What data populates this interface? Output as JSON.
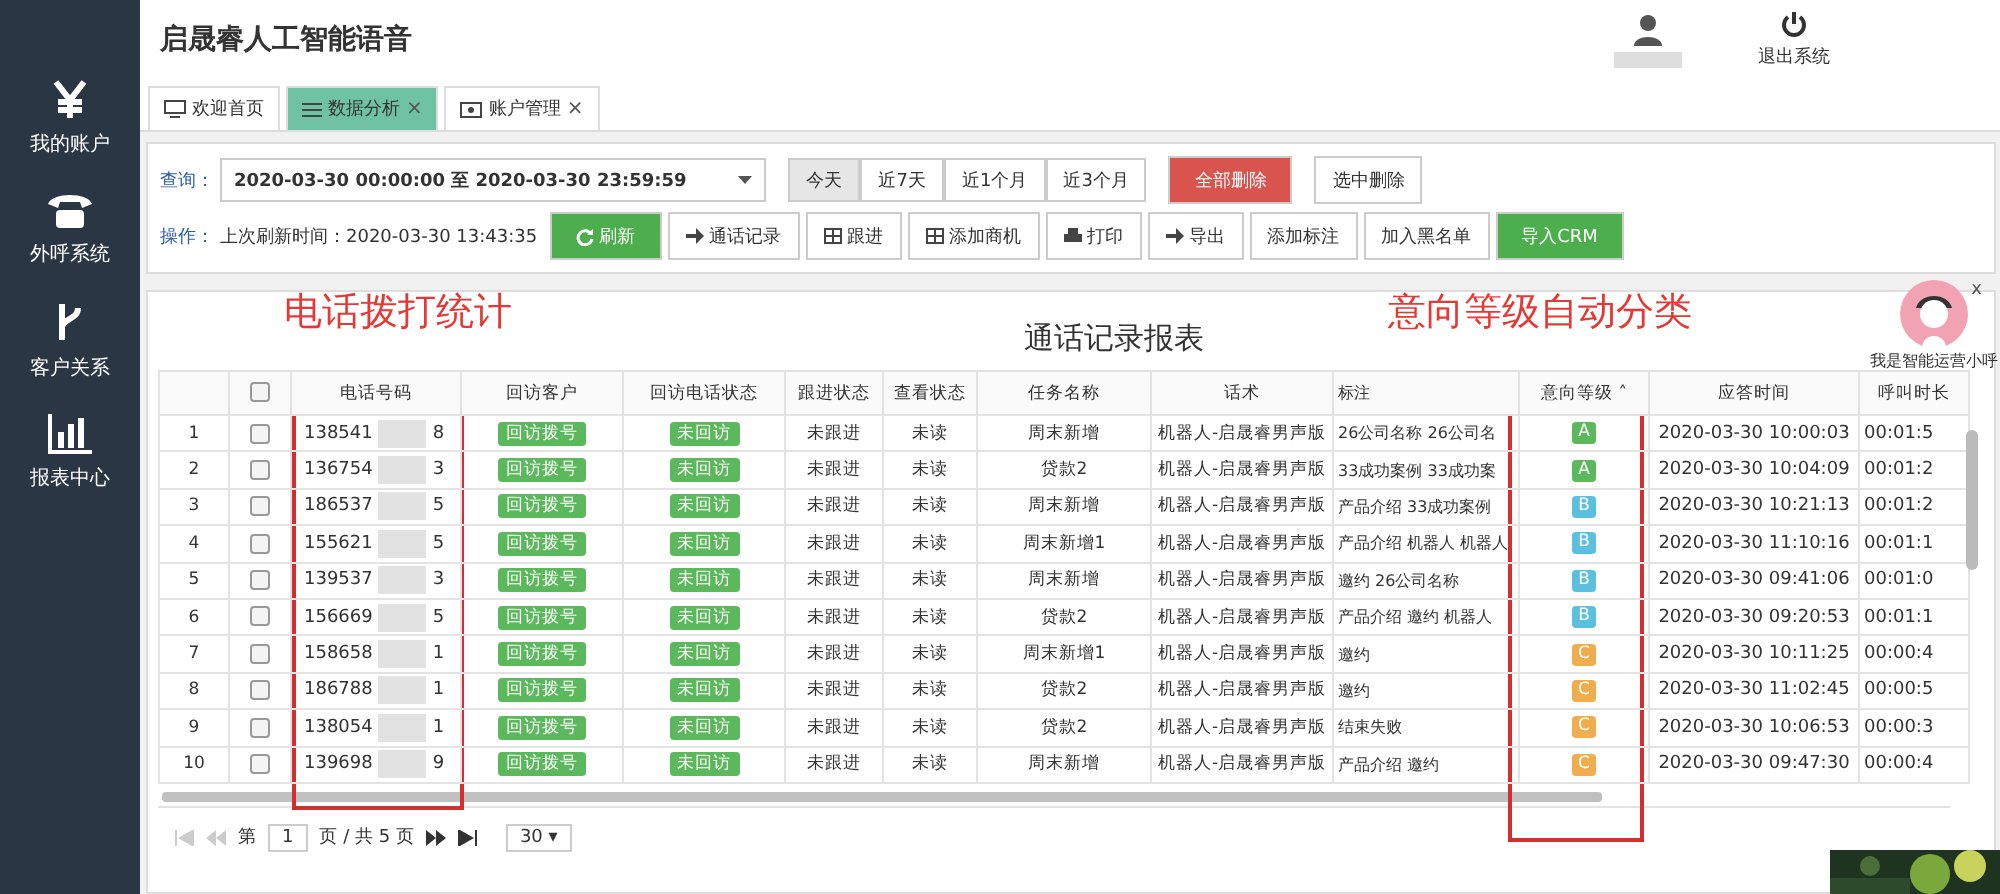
{
  "sidebar": {
    "items": [
      {
        "label": "我的账户"
      },
      {
        "label": "外呼系统"
      },
      {
        "label": "客户关系"
      },
      {
        "label": "报表中心"
      }
    ]
  },
  "header": {
    "title": "启晟睿人工智能语音",
    "logout": "退出系统"
  },
  "tabs": [
    {
      "label": "欢迎首页",
      "selected": false
    },
    {
      "label": "数据分析",
      "selected": true,
      "close": "×"
    },
    {
      "label": "账户管理",
      "selected": false,
      "close": "×"
    }
  ],
  "query": {
    "label": "查询：",
    "range": "2020-03-30 00:00:00 至 2020-03-30 23:59:59",
    "ranges": [
      {
        "label": "今天",
        "selected": true
      },
      {
        "label": "近7天",
        "selected": false
      },
      {
        "label": "近1个月",
        "selected": false
      },
      {
        "label": "近3个月",
        "selected": false
      }
    ],
    "delete_all": "全部删除",
    "delete_selected": "选中删除"
  },
  "ops": {
    "label": "操作：",
    "refresh_time": "上次刷新时间：2020-03-30 13:43:35",
    "buttons": [
      {
        "label": "刷新",
        "kind": "green"
      },
      {
        "label": "通话记录",
        "kind": "plain"
      },
      {
        "label": "跟进",
        "kind": "plain"
      },
      {
        "label": "添加商机",
        "kind": "plain"
      },
      {
        "label": "打印",
        "kind": "plain"
      },
      {
        "label": "导出",
        "kind": "plain"
      },
      {
        "label": "添加标注",
        "kind": "plain"
      },
      {
        "label": "加入黑名单",
        "kind": "plain"
      },
      {
        "label": "导入CRM",
        "kind": "green"
      }
    ]
  },
  "annotations": {
    "left": "电话拨打统计",
    "right": "意向等级自动分类"
  },
  "assistant": {
    "caption": "我是智能运营小呼",
    "close": "x"
  },
  "table": {
    "title": "通话记录报表",
    "all_checked": false,
    "columns": [
      "电话号码",
      "回访客户",
      "回访电话状态",
      "跟进状态",
      "查看状态",
      "任务名称",
      "话术",
      "标注",
      "意向等级 ˄",
      "应答时间",
      "呼叫时长"
    ],
    "rows": [
      {
        "index": "1",
        "checked": false,
        "phone_start": "138541",
        "phone_end": "8",
        "callback": "回访拨号",
        "call_status": "未回访",
        "follow": "未跟进",
        "read": "未读",
        "task": "周末新增",
        "script": "机器人-启晟睿男声版",
        "note": "26公司名称 26公司名",
        "grade": "A",
        "color": "#5cb85c",
        "answered": "2020-03-30 10:00:03",
        "duration": "00:01:5"
      },
      {
        "index": "2",
        "checked": false,
        "phone_start": "136754",
        "phone_end": "3",
        "callback": "回访拨号",
        "call_status": "未回访",
        "follow": "未跟进",
        "read": "未读",
        "task": "贷款2",
        "script": "机器人-启晟睿男声版",
        "note": "33成功案例 33成功案",
        "grade": "A",
        "color": "#5cb85c",
        "answered": "2020-03-30 10:04:09",
        "duration": "00:01:2"
      },
      {
        "index": "3",
        "checked": false,
        "phone_start": "186537",
        "phone_end": "5",
        "callback": "回访拨号",
        "call_status": "未回访",
        "follow": "未跟进",
        "read": "未读",
        "task": "周末新增",
        "script": "机器人-启晟睿男声版",
        "note": "产品介绍 33成功案例",
        "grade": "B",
        "color": "#5bc0de",
        "answered": "2020-03-30 10:21:13",
        "duration": "00:01:2"
      },
      {
        "index": "4",
        "checked": false,
        "phone_start": "155621",
        "phone_end": "5",
        "callback": "回访拨号",
        "call_status": "未回访",
        "follow": "未跟进",
        "read": "未读",
        "task": "周末新增1",
        "script": "机器人-启晟睿男声版",
        "note": "产品介绍 机器人 机器人",
        "grade": "B",
        "color": "#5bc0de",
        "answered": "2020-03-30 11:10:16",
        "duration": "00:01:1"
      },
      {
        "index": "5",
        "checked": false,
        "phone_start": "139537",
        "phone_end": "3",
        "callback": "回访拨号",
        "call_status": "未回访",
        "follow": "未跟进",
        "read": "未读",
        "task": "周末新增",
        "script": "机器人-启晟睿男声版",
        "note": "邀约 26公司名称",
        "grade": "B",
        "color": "#5bc0de",
        "answered": "2020-03-30 09:41:06",
        "duration": "00:01:0"
      },
      {
        "index": "6",
        "checked": false,
        "phone_start": "156669",
        "phone_end": "5",
        "callback": "回访拨号",
        "call_status": "未回访",
        "follow": "未跟进",
        "read": "未读",
        "task": "贷款2",
        "script": "机器人-启晟睿男声版",
        "note": "产品介绍 邀约 机器人",
        "grade": "B",
        "color": "#5bc0de",
        "answered": "2020-03-30 09:20:53",
        "duration": "00:01:1"
      },
      {
        "index": "7",
        "checked": false,
        "phone_start": "158658",
        "phone_end": "1",
        "callback": "回访拨号",
        "call_status": "未回访",
        "follow": "未跟进",
        "read": "未读",
        "task": "周末新增1",
        "script": "机器人-启晟睿男声版",
        "note": "邀约",
        "grade": "C",
        "color": "#f0ad4e",
        "answered": "2020-03-30 10:11:25",
        "duration": "00:00:4"
      },
      {
        "index": "8",
        "checked": false,
        "phone_start": "186788",
        "phone_end": "1",
        "callback": "回访拨号",
        "call_status": "未回访",
        "follow": "未跟进",
        "read": "未读",
        "task": "贷款2",
        "script": "机器人-启晟睿男声版",
        "note": "邀约",
        "grade": "C",
        "color": "#f0ad4e",
        "answered": "2020-03-30 11:02:45",
        "duration": "00:00:5"
      },
      {
        "index": "9",
        "checked": false,
        "phone_start": "138054",
        "phone_end": "1",
        "callback": "回访拨号",
        "call_status": "未回访",
        "follow": "未跟进",
        "read": "未读",
        "task": "贷款2",
        "script": "机器人-启晟睿男声版",
        "note": "结束失败",
        "grade": "C",
        "color": "#f0ad4e",
        "answered": "2020-03-30 10:06:53",
        "duration": "00:00:3"
      },
      {
        "index": "10",
        "checked": false,
        "phone_start": "139698",
        "phone_end": "9",
        "callback": "回访拨号",
        "call_status": "未回访",
        "follow": "未跟进",
        "read": "未读",
        "task": "周末新增",
        "script": "机器人-启晟睿男声版",
        "note": "产品介绍 邀约",
        "grade": "C",
        "color": "#f0ad4e",
        "answered": "2020-03-30 09:47:30",
        "duration": "00:00:4"
      }
    ]
  },
  "pager": {
    "page_prefix": "第",
    "page": "1",
    "page_suffix": "页 / 共 5 页",
    "page_size": "30 ▾"
  }
}
